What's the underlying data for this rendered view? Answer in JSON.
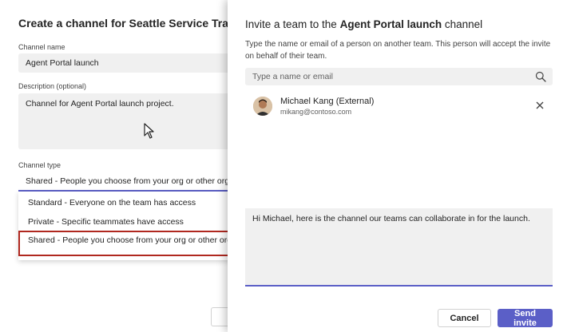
{
  "background_dialog": {
    "title": "Create a channel for Seattle Service Tracking",
    "channel_name_label": "Channel name",
    "channel_name_value": "Agent Portal launch",
    "description_label": "Description (optional)",
    "description_value": "Channel for Agent Portal launch project.",
    "channel_type_label": "Channel type",
    "channel_type_selected": "Shared - People you choose from your org or other orgs",
    "channel_type_options": [
      "Standard - Everyone on the team has access",
      "Private - Specific teammates have access",
      "Shared - People you choose from your org or other orgs"
    ]
  },
  "invite_dialog": {
    "title_prefix": "Invite a team to the ",
    "title_channel": "Agent Portal launch",
    "title_suffix": " channel",
    "description": "Type the name or email of a person on another team. This person will accept the invite on behalf of their team.",
    "search_placeholder": "Type a name or email",
    "selected_person": {
      "name": "Michael Kang (External)",
      "email": "mikang@contoso.com"
    },
    "message": "Hi Michael, here is the channel our teams can collaborate in for the launch.",
    "cancel_label": "Cancel",
    "send_label": "Send invite"
  },
  "colors": {
    "accent": "#5b5fc7",
    "highlight_border": "#b0281f",
    "field_bg": "#f0f0f0"
  },
  "icons": [
    "search-icon",
    "close-icon",
    "mouse-cursor-icon",
    "avatar"
  ]
}
